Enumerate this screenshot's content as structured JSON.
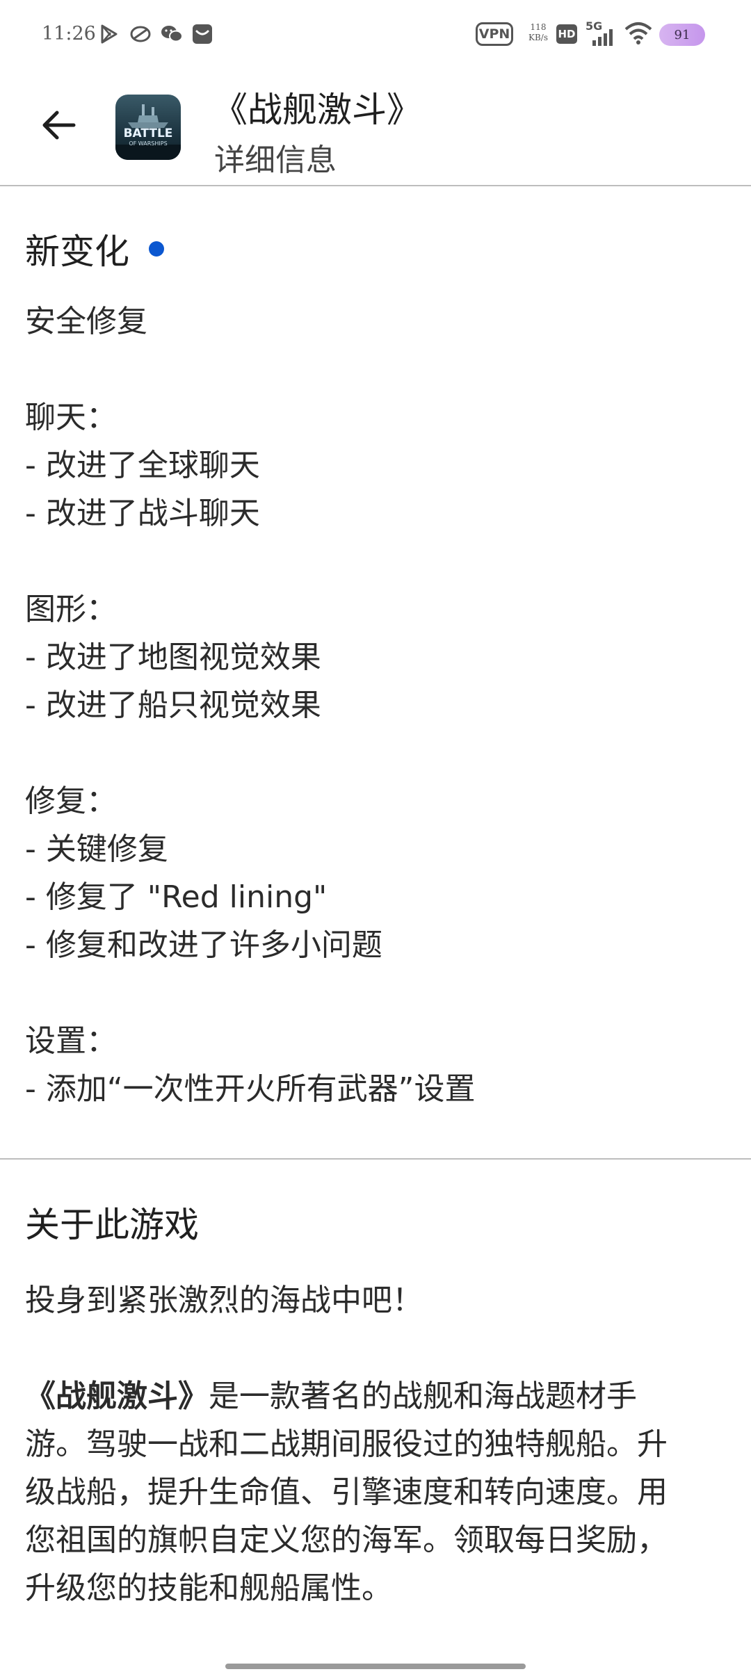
{
  "status_bar": {
    "time": "11:26",
    "vpn": "VPN",
    "net_speed_value": "118",
    "net_speed_unit": "KB/s",
    "hd": "HD",
    "network": "5G",
    "battery": "91",
    "icons": [
      "play-store-icon",
      "sync-icon",
      "wechat-icon",
      "mail-icon",
      "signal-icon",
      "wifi-icon",
      "battery-icon"
    ]
  },
  "header": {
    "title": "《战舰激斗》",
    "subtitle": "详细信息",
    "app_icon_text": "BATTLE",
    "app_icon_subtext": "OF WARSHIPS"
  },
  "whats_new": {
    "title": "新变化",
    "lines": [
      "安全修复",
      "",
      "聊天：",
      "- 改进了全球聊天",
      "- 改进了战斗聊天",
      "",
      "图形：",
      "- 改进了地图视觉效果",
      "- 改进了船只视觉效果",
      "",
      "修复：",
      "- 关键修复",
      "- 修复了 \"Red lining\"",
      "- 修复和改进了许多小问题",
      "",
      "设置：",
      "- 添加“一次性开火所有武器”设置"
    ]
  },
  "about": {
    "title": "关于此游戏",
    "intro": "投身到紧张激烈的海战中吧！",
    "body_bold": "《战舰激斗》",
    "body_line1": "是一款著名的战舰和海战题材手",
    "body_line2": "游。驾驶一战和二战期间服役过的独特舰船。升",
    "body_line3": "级战船，提升生命值、引擎速度和转向速度。用",
    "body_line4": "您祖国的旗帜自定义您的海军。领取每日奖励，",
    "body_line5": "升级您的技能和舰船属性。"
  },
  "colors": {
    "accent_dot": "#0b57d0",
    "battery": "#c596ec"
  }
}
